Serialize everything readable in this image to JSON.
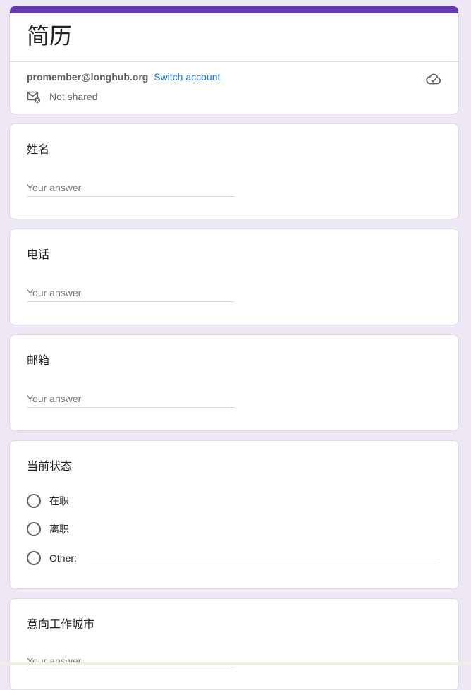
{
  "form": {
    "title": "简历",
    "account_email": "promember@longhub.org",
    "switch_account": "Switch account",
    "share_status": "Not shared"
  },
  "questions": [
    {
      "title": "姓名",
      "placeholder": "Your answer"
    },
    {
      "title": "电话",
      "placeholder": "Your answer"
    },
    {
      "title": "邮箱",
      "placeholder": "Your answer"
    },
    {
      "title": "当前状态",
      "options": [
        "在职",
        "离职",
        "Other:"
      ]
    },
    {
      "title": "意向工作城市",
      "placeholder": "Your answer"
    }
  ],
  "icons": {
    "share": "mail-blocked-icon",
    "save": "cloud-icon"
  },
  "colors": {
    "accent": "#673ab7",
    "background": "#ede7f6",
    "link": "#1a73e8"
  }
}
